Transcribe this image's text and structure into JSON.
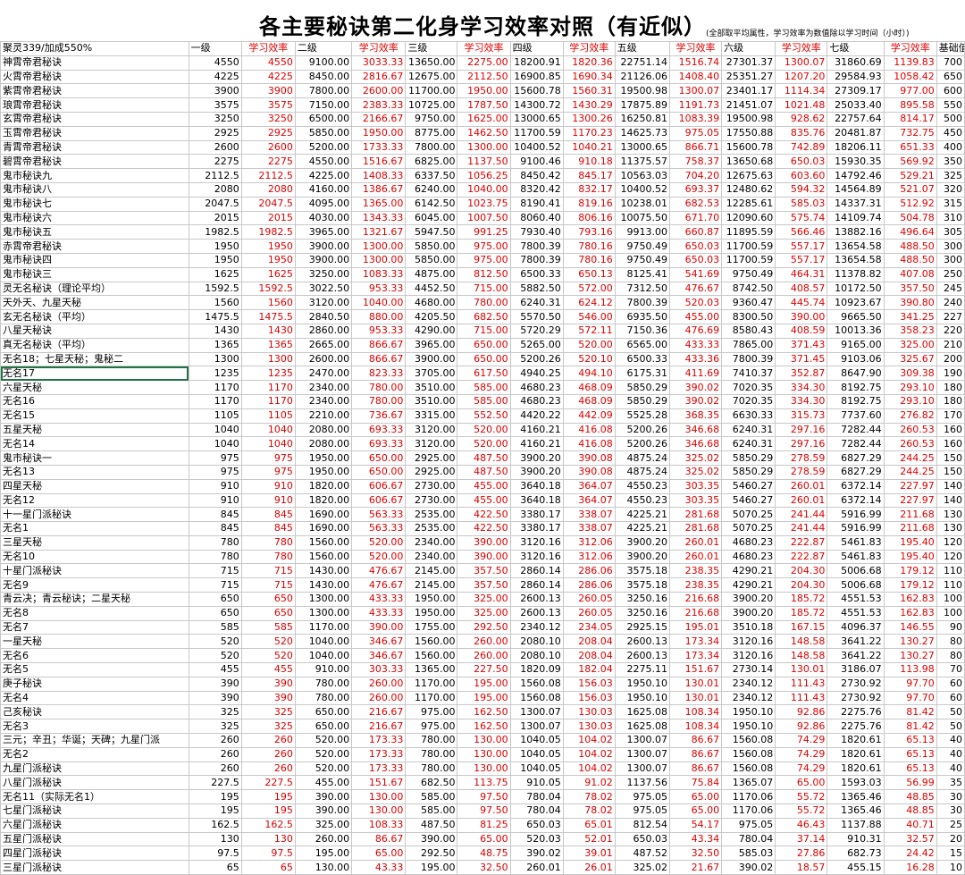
{
  "title": "各主要秘诀第二化身学习效率对照（有近似）",
  "note": "(全部取平均属性，学习效率为数值除以学习时间（小时）)",
  "header": [
    "聚灵339/加成550%",
    "一级",
    "学习效率",
    "二级",
    "学习效率",
    "三级",
    "学习效率",
    "四级",
    "学习效率",
    "五级",
    "学习效率",
    "六级",
    "学习效率",
    "七级",
    "学习效率",
    "基础值"
  ],
  "selected_row": 22,
  "rows": [
    [
      "神霄帝君秘诀",
      "4550",
      "4550",
      "9100.00",
      "3033.33",
      "13650.00",
      "2275.00",
      "18200.91",
      "1820.36",
      "22751.14",
      "1516.74",
      "27301.37",
      "1300.07",
      "31860.69",
      "1139.83",
      "700"
    ],
    [
      "火霄帝君秘诀",
      "4225",
      "4225",
      "8450.00",
      "2816.67",
      "12675.00",
      "2112.50",
      "16900.85",
      "1690.34",
      "21126.06",
      "1408.40",
      "25351.27",
      "1207.20",
      "29584.93",
      "1058.42",
      "650"
    ],
    [
      "紫霄帝君秘诀",
      "3900",
      "3900",
      "7800.00",
      "2600.00",
      "11700.00",
      "1950.00",
      "15600.78",
      "1560.31",
      "19500.98",
      "1300.07",
      "23401.17",
      "1114.34",
      "27309.17",
      "977.00",
      "600"
    ],
    [
      "琅霄帝君秘诀",
      "3575",
      "3575",
      "7150.00",
      "2383.33",
      "10725.00",
      "1787.50",
      "14300.72",
      "1430.29",
      "17875.89",
      "1191.73",
      "21451.07",
      "1021.48",
      "25033.40",
      "895.58",
      "550"
    ],
    [
      "玄霄帝君秘诀",
      "3250",
      "3250",
      "6500.00",
      "2166.67",
      "9750.00",
      "1625.00",
      "13000.65",
      "1300.26",
      "16250.81",
      "1083.39",
      "19500.98",
      "928.62",
      "22757.64",
      "814.17",
      "500"
    ],
    [
      "玉霄帝君秘诀",
      "2925",
      "2925",
      "5850.00",
      "1950.00",
      "8775.00",
      "1462.50",
      "11700.59",
      "1170.23",
      "14625.73",
      "975.05",
      "17550.88",
      "835.76",
      "20481.87",
      "732.75",
      "450"
    ],
    [
      "青霄帝君秘诀",
      "2600",
      "2600",
      "5200.00",
      "1733.33",
      "7800.00",
      "1300.00",
      "10400.52",
      "1040.21",
      "13000.65",
      "866.71",
      "15600.78",
      "742.89",
      "18206.11",
      "651.33",
      "400"
    ],
    [
      "碧霄帝君秘诀",
      "2275",
      "2275",
      "4550.00",
      "1516.67",
      "6825.00",
      "1137.50",
      "9100.46",
      "910.18",
      "11375.57",
      "758.37",
      "13650.68",
      "650.03",
      "15930.35",
      "569.92",
      "350"
    ],
    [
      "鬼市秘诀九",
      "2112.5",
      "2112.5",
      "4225.00",
      "1408.33",
      "6337.50",
      "1056.25",
      "8450.42",
      "845.17",
      "10563.03",
      "704.20",
      "12675.63",
      "603.60",
      "14792.46",
      "529.21",
      "325"
    ],
    [
      "鬼市秘诀八",
      "2080",
      "2080",
      "4160.00",
      "1386.67",
      "6240.00",
      "1040.00",
      "8320.42",
      "832.17",
      "10400.52",
      "693.37",
      "12480.62",
      "594.32",
      "14564.89",
      "521.07",
      "320"
    ],
    [
      "鬼市秘诀七",
      "2047.5",
      "2047.5",
      "4095.00",
      "1365.00",
      "6142.50",
      "1023.75",
      "8190.41",
      "819.16",
      "10238.01",
      "682.53",
      "12285.61",
      "585.03",
      "14337.31",
      "512.92",
      "315"
    ],
    [
      "鬼市秘诀六",
      "2015",
      "2015",
      "4030.00",
      "1343.33",
      "6045.00",
      "1007.50",
      "8060.40",
      "806.16",
      "10075.50",
      "671.70",
      "12090.60",
      "575.74",
      "14109.74",
      "504.78",
      "310"
    ],
    [
      "鬼市秘诀五",
      "1982.5",
      "1982.5",
      "3965.00",
      "1321.67",
      "5947.50",
      "991.25",
      "7930.40",
      "793.16",
      "9913.00",
      "660.87",
      "11895.59",
      "566.46",
      "13882.16",
      "496.64",
      "305"
    ],
    [
      "赤霄帝君秘诀",
      "1950",
      "1950",
      "3900.00",
      "1300.00",
      "5850.00",
      "975.00",
      "7800.39",
      "780.16",
      "9750.49",
      "650.03",
      "11700.59",
      "557.17",
      "13654.58",
      "488.50",
      "300"
    ],
    [
      "鬼市秘诀四",
      "1950",
      "1950",
      "3900.00",
      "1300.00",
      "5850.00",
      "975.00",
      "7800.39",
      "780.16",
      "9750.49",
      "650.03",
      "11700.59",
      "557.17",
      "13654.58",
      "488.50",
      "300"
    ],
    [
      "鬼市秘诀三",
      "1625",
      "1625",
      "3250.00",
      "1083.33",
      "4875.00",
      "812.50",
      "6500.33",
      "650.13",
      "8125.41",
      "541.69",
      "9750.49",
      "464.31",
      "11378.82",
      "407.08",
      "250"
    ],
    [
      "灵无名秘诀（理论平均）",
      "1592.5",
      "1592.5",
      "3022.50",
      "953.33",
      "4452.50",
      "715.00",
      "5882.50",
      "572.00",
      "7312.50",
      "476.67",
      "8742.50",
      "408.57",
      "10172.50",
      "357.50",
      "245"
    ],
    [
      "天外天、九星天秘",
      "1560",
      "1560",
      "3120.00",
      "1040.00",
      "4680.00",
      "780.00",
      "6240.31",
      "624.12",
      "7800.39",
      "520.03",
      "9360.47",
      "445.74",
      "10923.67",
      "390.80",
      "240"
    ],
    [
      "玄无名秘诀（平均）",
      "1475.5",
      "1475.5",
      "2840.50",
      "880.00",
      "4205.50",
      "682.50",
      "5570.50",
      "546.00",
      "6935.50",
      "455.00",
      "8300.50",
      "390.00",
      "9665.50",
      "341.25",
      "227"
    ],
    [
      "八星天秘诀",
      "1430",
      "1430",
      "2860.00",
      "953.33",
      "4290.00",
      "715.00",
      "5720.29",
      "572.11",
      "7150.36",
      "476.69",
      "8580.43",
      "408.59",
      "10013.36",
      "358.23",
      "220"
    ],
    [
      "真无名秘诀（平均）",
      "1365",
      "1365",
      "2665.00",
      "866.67",
      "3965.00",
      "650.00",
      "5265.00",
      "520.00",
      "6565.00",
      "433.33",
      "7865.00",
      "371.43",
      "9165.00",
      "325.00",
      "210"
    ],
    [
      "无名18；七星天秘；鬼秘二",
      "1300",
      "1300",
      "2600.00",
      "866.67",
      "3900.00",
      "650.00",
      "5200.26",
      "520.10",
      "6500.33",
      "433.36",
      "7800.39",
      "371.45",
      "9103.06",
      "325.67",
      "200"
    ],
    [
      "无名17",
      "1235",
      "1235",
      "2470.00",
      "823.33",
      "3705.00",
      "617.50",
      "4940.25",
      "494.10",
      "6175.31",
      "411.69",
      "7410.37",
      "352.87",
      "8647.90",
      "309.38",
      "190"
    ],
    [
      "六星天秘",
      "1170",
      "1170",
      "2340.00",
      "780.00",
      "3510.00",
      "585.00",
      "4680.23",
      "468.09",
      "5850.29",
      "390.02",
      "7020.35",
      "334.30",
      "8192.75",
      "293.10",
      "180"
    ],
    [
      "无名16",
      "1170",
      "1170",
      "2340.00",
      "780.00",
      "3510.00",
      "585.00",
      "4680.23",
      "468.09",
      "5850.29",
      "390.02",
      "7020.35",
      "334.30",
      "8192.75",
      "293.10",
      "180"
    ],
    [
      "无名15",
      "1105",
      "1105",
      "2210.00",
      "736.67",
      "3315.00",
      "552.50",
      "4420.22",
      "442.09",
      "5525.28",
      "368.35",
      "6630.33",
      "315.73",
      "7737.60",
      "276.82",
      "170"
    ],
    [
      "五星天秘",
      "1040",
      "1040",
      "2080.00",
      "693.33",
      "3120.00",
      "520.00",
      "4160.21",
      "416.08",
      "5200.26",
      "346.68",
      "6240.31",
      "297.16",
      "7282.44",
      "260.53",
      "160"
    ],
    [
      "无名14",
      "1040",
      "1040",
      "2080.00",
      "693.33",
      "3120.00",
      "520.00",
      "4160.21",
      "416.08",
      "5200.26",
      "346.68",
      "6240.31",
      "297.16",
      "7282.44",
      "260.53",
      "160"
    ],
    [
      "鬼市秘诀一",
      "975",
      "975",
      "1950.00",
      "650.00",
      "2925.00",
      "487.50",
      "3900.20",
      "390.08",
      "4875.24",
      "325.02",
      "5850.29",
      "278.59",
      "6827.29",
      "244.25",
      "150"
    ],
    [
      "无名13",
      "975",
      "975",
      "1950.00",
      "650.00",
      "2925.00",
      "487.50",
      "3900.20",
      "390.08",
      "4875.24",
      "325.02",
      "5850.29",
      "278.59",
      "6827.29",
      "244.25",
      "150"
    ],
    [
      "四星天秘",
      "910",
      "910",
      "1820.00",
      "606.67",
      "2730.00",
      "455.00",
      "3640.18",
      "364.07",
      "4550.23",
      "303.35",
      "5460.27",
      "260.01",
      "6372.14",
      "227.97",
      "140"
    ],
    [
      "无名12",
      "910",
      "910",
      "1820.00",
      "606.67",
      "2730.00",
      "455.00",
      "3640.18",
      "364.07",
      "4550.23",
      "303.35",
      "5460.27",
      "260.01",
      "6372.14",
      "227.97",
      "140"
    ],
    [
      "十一星门派秘诀",
      "845",
      "845",
      "1690.00",
      "563.33",
      "2535.00",
      "422.50",
      "3380.17",
      "338.07",
      "4225.21",
      "281.68",
      "5070.25",
      "241.44",
      "5916.99",
      "211.68",
      "130"
    ],
    [
      "无名1",
      "845",
      "845",
      "1690.00",
      "563.33",
      "2535.00",
      "422.50",
      "3380.17",
      "338.07",
      "4225.21",
      "281.68",
      "5070.25",
      "241.44",
      "5916.99",
      "211.68",
      "130"
    ],
    [
      "三星天秘",
      "780",
      "780",
      "1560.00",
      "520.00",
      "2340.00",
      "390.00",
      "3120.16",
      "312.06",
      "3900.20",
      "260.01",
      "4680.23",
      "222.87",
      "5461.83",
      "195.40",
      "120"
    ],
    [
      "无名10",
      "780",
      "780",
      "1560.00",
      "520.00",
      "2340.00",
      "390.00",
      "3120.16",
      "312.06",
      "3900.20",
      "260.01",
      "4680.23",
      "222.87",
      "5461.83",
      "195.40",
      "120"
    ],
    [
      "十星门派秘诀",
      "715",
      "715",
      "1430.00",
      "476.67",
      "2145.00",
      "357.50",
      "2860.14",
      "286.06",
      "3575.18",
      "238.35",
      "4290.21",
      "204.30",
      "5006.68",
      "179.12",
      "110"
    ],
    [
      "无名9",
      "715",
      "715",
      "1430.00",
      "476.67",
      "2145.00",
      "357.50",
      "2860.14",
      "286.06",
      "3575.18",
      "238.35",
      "4290.21",
      "204.30",
      "5006.68",
      "179.12",
      "110"
    ],
    [
      "青云决；青云秘诀；二星天秘",
      "650",
      "650",
      "1300.00",
      "433.33",
      "1950.00",
      "325.00",
      "2600.13",
      "260.05",
      "3250.16",
      "216.68",
      "3900.20",
      "185.72",
      "4551.53",
      "162.83",
      "100"
    ],
    [
      "无名8",
      "650",
      "650",
      "1300.00",
      "433.33",
      "1950.00",
      "325.00",
      "2600.13",
      "260.05",
      "3250.16",
      "216.68",
      "3900.20",
      "185.72",
      "4551.53",
      "162.83",
      "100"
    ],
    [
      "无名7",
      "585",
      "585",
      "1170.00",
      "390.00",
      "1755.00",
      "292.50",
      "2340.12",
      "234.05",
      "2925.15",
      "195.01",
      "3510.18",
      "167.15",
      "4096.37",
      "146.55",
      "90"
    ],
    [
      "一星天秘",
      "520",
      "520",
      "1040.00",
      "346.67",
      "1560.00",
      "260.00",
      "2080.10",
      "208.04",
      "2600.13",
      "173.34",
      "3120.16",
      "148.58",
      "3641.22",
      "130.27",
      "80"
    ],
    [
      "无名6",
      "520",
      "520",
      "1040.00",
      "346.67",
      "1560.00",
      "260.00",
      "2080.10",
      "208.04",
      "2600.13",
      "173.34",
      "3120.16",
      "148.58",
      "3641.22",
      "130.27",
      "80"
    ],
    [
      "无名5",
      "455",
      "455",
      "910.00",
      "303.33",
      "1365.00",
      "227.50",
      "1820.09",
      "182.04",
      "2275.11",
      "151.67",
      "2730.14",
      "130.01",
      "3186.07",
      "113.98",
      "70"
    ],
    [
      "庚子秘诀",
      "390",
      "390",
      "780.00",
      "260.00",
      "1170.00",
      "195.00",
      "1560.08",
      "156.03",
      "1950.10",
      "130.01",
      "2340.12",
      "111.43",
      "2730.92",
      "97.70",
      "60"
    ],
    [
      "无名4",
      "390",
      "390",
      "780.00",
      "260.00",
      "1170.00",
      "195.00",
      "1560.08",
      "156.03",
      "1950.10",
      "130.01",
      "2340.12",
      "111.43",
      "2730.92",
      "97.70",
      "60"
    ],
    [
      "己亥秘诀",
      "325",
      "325",
      "650.00",
      "216.67",
      "975.00",
      "162.50",
      "1300.07",
      "130.03",
      "1625.08",
      "108.34",
      "1950.10",
      "92.86",
      "2275.76",
      "81.42",
      "50"
    ],
    [
      "无名3",
      "325",
      "325",
      "650.00",
      "216.67",
      "975.00",
      "162.50",
      "1300.07",
      "130.03",
      "1625.08",
      "108.34",
      "1950.10",
      "92.86",
      "2275.76",
      "81.42",
      "50"
    ],
    [
      "三元；辛丑；华诞；天碑；九星门派",
      "260",
      "260",
      "520.00",
      "173.33",
      "780.00",
      "130.00",
      "1040.05",
      "104.02",
      "1300.07",
      "86.67",
      "1560.08",
      "74.29",
      "1820.61",
      "65.13",
      "40"
    ],
    [
      "无名2",
      "260",
      "260",
      "520.00",
      "173.33",
      "780.00",
      "130.00",
      "1040.05",
      "104.02",
      "1300.07",
      "86.67",
      "1560.08",
      "74.29",
      "1820.61",
      "65.13",
      "40"
    ],
    [
      "九星门派秘诀",
      "260",
      "260",
      "520.00",
      "173.33",
      "780.00",
      "130.00",
      "1040.05",
      "104.02",
      "1300.07",
      "86.67",
      "1560.08",
      "74.29",
      "1820.61",
      "65.13",
      "40"
    ],
    [
      "八星门派秘诀",
      "227.5",
      "227.5",
      "455.00",
      "151.67",
      "682.50",
      "113.75",
      "910.05",
      "91.02",
      "1137.56",
      "75.84",
      "1365.07",
      "65.00",
      "1593.03",
      "56.99",
      "35"
    ],
    [
      "无名11（实际无名1）",
      "195",
      "195",
      "390.00",
      "130.00",
      "585.00",
      "97.50",
      "780.04",
      "78.02",
      "975.05",
      "65.00",
      "1170.06",
      "55.72",
      "1365.46",
      "48.85",
      "30"
    ],
    [
      "七星门派秘诀",
      "195",
      "195",
      "390.00",
      "130.00",
      "585.00",
      "97.50",
      "780.04",
      "78.02",
      "975.05",
      "65.00",
      "1170.06",
      "55.72",
      "1365.46",
      "48.85",
      "30"
    ],
    [
      "六星门派秘诀",
      "162.5",
      "162.5",
      "325.00",
      "108.33",
      "487.50",
      "81.25",
      "650.03",
      "65.01",
      "812.54",
      "54.17",
      "975.05",
      "46.43",
      "1137.88",
      "40.71",
      "25"
    ],
    [
      "五星门派秘诀",
      "130",
      "130",
      "260.00",
      "86.67",
      "390.00",
      "65.00",
      "520.03",
      "52.01",
      "650.03",
      "43.34",
      "780.04",
      "37.14",
      "910.31",
      "32.57",
      "20"
    ],
    [
      "四星门派秘诀",
      "97.5",
      "97.5",
      "195.00",
      "65.00",
      "292.50",
      "48.75",
      "390.02",
      "39.01",
      "487.52",
      "32.50",
      "585.03",
      "27.86",
      "682.73",
      "24.42",
      "15"
    ],
    [
      "三星门派秘诀",
      "65",
      "65",
      "130.00",
      "43.33",
      "195.00",
      "32.50",
      "260.01",
      "26.01",
      "325.02",
      "21.67",
      "390.02",
      "18.57",
      "455.15",
      "16.28",
      "10"
    ]
  ]
}
